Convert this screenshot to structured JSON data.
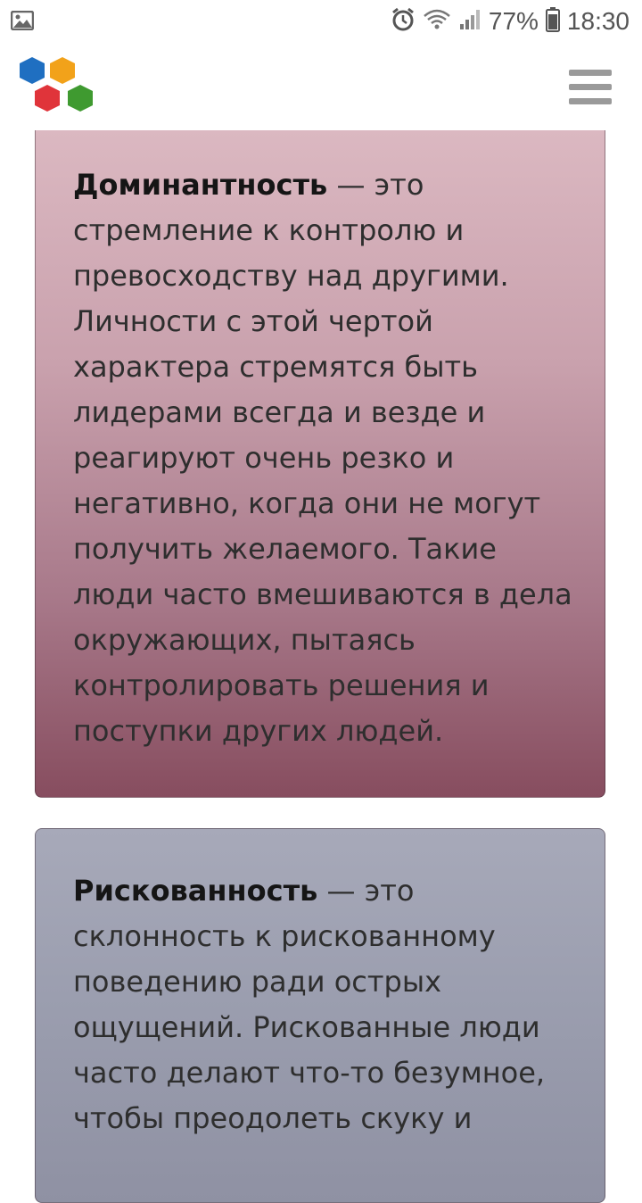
{
  "status_bar": {
    "battery": "77%",
    "time": "18:30"
  },
  "cards": [
    {
      "term": "Доминантность",
      "definition": " — это стремление к контролю и превосходству над другими. Личности с этой чертой характера стремятся быть лидерами всегда и везде и реагируют очень резко и негативно, когда они не могут получить желаемого. Такие люди часто вмешиваются в дела окружающих, пытаясь контролировать решения и поступки других людей."
    },
    {
      "term": "Рискованность",
      "definition": " — это склонность к рискованному поведению ради острых ощущений. Рискованные люди часто делают что-то безумное, чтобы преодолеть скуку и"
    }
  ]
}
